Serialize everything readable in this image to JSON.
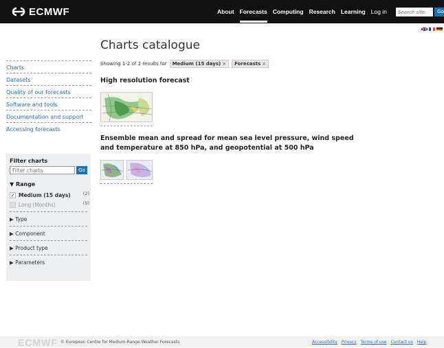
{
  "header": {
    "logo_text": "ECMWF",
    "nav": [
      "About",
      "Forecasts",
      "Computing",
      "Research",
      "Learning"
    ],
    "active_nav": "Forecasts",
    "login": "Log in",
    "search_placeholder": "Search site",
    "search_go": "Go",
    "bg_color": "#111111"
  },
  "page": {
    "title": "Charts catalogue",
    "results_text": "Showing 1-2 of 2 results for",
    "chips": [
      {
        "label": "Medium (15 days)",
        "remove": "×"
      },
      {
        "label": "Forecasts",
        "remove": "×"
      }
    ]
  },
  "sidebar": {
    "items": [
      {
        "label": "Charts"
      },
      {
        "label": "Datasets"
      },
      {
        "label": "Quality of our forecasts"
      },
      {
        "label": "Software and tools"
      },
      {
        "label": "Documentation and support"
      },
      {
        "label": "Accessing forecasts"
      }
    ],
    "link_color": "#2a6ebb"
  },
  "filter": {
    "title": "Filter charts",
    "placeholder": "Filter charts",
    "go": "Go",
    "range_label": "Range",
    "options": [
      {
        "label": "Medium (15 days)",
        "count": "(2)",
        "checked": true
      },
      {
        "label": "Long (Months)",
        "count": "(5)",
        "checked": false
      }
    ],
    "sections": [
      "Type",
      "Component",
      "Product type",
      "Parameters"
    ]
  },
  "results": [
    {
      "title": "High resolution forecast"
    },
    {
      "title": "Ensemble mean and spread for mean sea level pressure, wind speed and temperature at 850 hPa, and geopotential at 500 hPa"
    }
  ],
  "footer": {
    "logo": "ECMWF",
    "copyright": "© European Centre for Medium-Range Weather Forecasts",
    "links": [
      "Accessibility",
      "Privacy",
      "Terms of use",
      "Contact us",
      "Help"
    ]
  },
  "accent_color": "#1a73b5"
}
